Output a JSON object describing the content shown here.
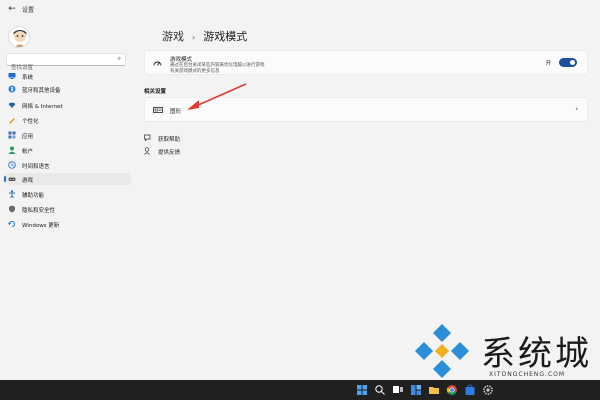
{
  "window": {
    "title": "设置"
  },
  "sidebar": {
    "search_placeholder": "查找设置",
    "items": [
      {
        "label": "系统",
        "icon": "system-icon",
        "color": "#1f6fd0"
      },
      {
        "label": "蓝牙和其他设备",
        "icon": "bluetooth-icon",
        "color": "#2a7de1"
      },
      {
        "label": "网络 & Internet",
        "icon": "network-icon",
        "color": "#2a5ea8"
      },
      {
        "label": "个性化",
        "icon": "personalization-icon",
        "color": "#d89a2a"
      },
      {
        "label": "应用",
        "icon": "apps-icon",
        "color": "#3a6fb5"
      },
      {
        "label": "帐户",
        "icon": "accounts-icon",
        "color": "#1e9a5a"
      },
      {
        "label": "时间和语言",
        "icon": "time-language-icon",
        "color": "#3a7bd5"
      },
      {
        "label": "游戏",
        "icon": "gaming-icon",
        "color": "#555555",
        "active": true
      },
      {
        "label": "辅助功能",
        "icon": "accessibility-icon",
        "color": "#2a6fc0"
      },
      {
        "label": "隐私和安全性",
        "icon": "privacy-shield-icon",
        "color": "#6b6b6b"
      },
      {
        "label": "Windows 更新",
        "icon": "windows-update-icon",
        "color": "#1f6fd0"
      }
    ]
  },
  "main": {
    "breadcrumb_parent": "游戏",
    "breadcrumb_sep": "›",
    "breadcrumb_current": "游戏模式",
    "game_mode": {
      "title": "游戏模式",
      "desc_line1": "通过在后台关闭某些内容来优化电脑以进行游戏",
      "desc_line2": "有关游戏模式的更多信息",
      "toggle_label": "开",
      "toggle_on": true
    },
    "related_title": "相关设置",
    "graphics_label": "图形",
    "chevron": "›",
    "links": [
      {
        "label": "获取帮助",
        "icon": "help-icon"
      },
      {
        "label": "提供反馈",
        "icon": "feedback-icon"
      }
    ]
  },
  "watermark": {
    "text": "系统城",
    "sub": "XITONGCHENG.COM"
  },
  "colors": {
    "accent": "#1f4fa0",
    "arrow": "#e03a2f",
    "taskbar": "#202020"
  },
  "taskbar": {
    "icons": [
      "windows-start-icon",
      "search-icon",
      "task-view-icon",
      "widgets-icon",
      "file-explorer-icon",
      "chrome-icon",
      "store-icon",
      "settings-icon"
    ]
  }
}
